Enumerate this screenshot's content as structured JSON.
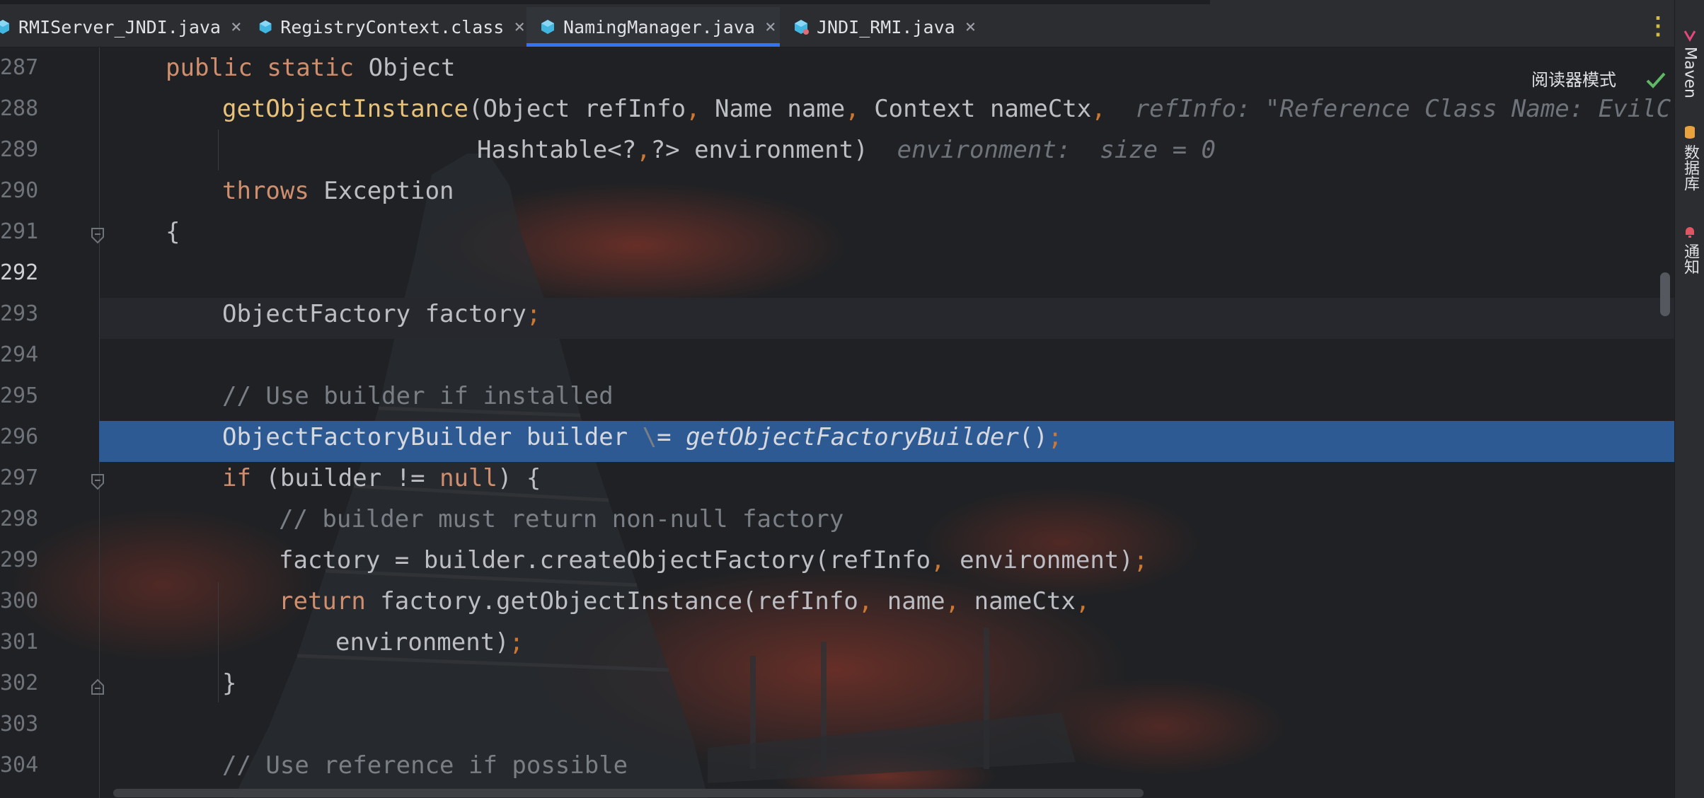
{
  "tabs": [
    {
      "label": "RMIServer_JNDI.java",
      "active": false
    },
    {
      "label": "RegistryContext.class",
      "active": false
    },
    {
      "label": "NamingManager.java",
      "active": true
    },
    {
      "label": "JNDI_RMI.java",
      "active": false
    }
  ],
  "tab_close_glyph": "×",
  "more_glyph": "⋮",
  "toolbar": {
    "reader_mode_label": "阅读器模式"
  },
  "right_tools": {
    "maven": "Maven",
    "database": "数据库",
    "notifications": "通知"
  },
  "colors": {
    "accent": "#3574f0",
    "selection": "#2e5a94",
    "keyword": "#cf8e6d",
    "function": "#e8c17a"
  },
  "editor": {
    "current_line": "292",
    "highlighted_line": "296",
    "lines": [
      {
        "num": "287"
      },
      {
        "num": "288"
      },
      {
        "num": "289"
      },
      {
        "num": "290"
      },
      {
        "num": "291"
      },
      {
        "num": "292"
      },
      {
        "num": "293"
      },
      {
        "num": "294"
      },
      {
        "num": "295"
      },
      {
        "num": "296"
      },
      {
        "num": "297"
      },
      {
        "num": "298"
      },
      {
        "num": "299"
      },
      {
        "num": "300"
      },
      {
        "num": "301"
      },
      {
        "num": "302"
      },
      {
        "num": "303"
      },
      {
        "num": "304"
      }
    ],
    "code": {
      "l287": {
        "kw1": "public",
        "kw2": "static",
        "type": "Object"
      },
      "l288": {
        "fn": "getObjectInstance",
        "open": "(",
        "p1": "Object refInfo",
        "c1": ",",
        "p2": " Name name",
        "c2": ",",
        "p3": " Context nameCtx",
        "c3": ",",
        "hint": "refInfo: \"Reference Class Name: EvilCla"
      },
      "l289": {
        "p": "Hashtable<?",
        "c": ",",
        "rest": "?> environment)",
        "hint": "environment:  size = 0"
      },
      "l290": {
        "kw": "throws",
        "exc": " Exception"
      },
      "l291": {
        "brace": "{"
      },
      "l293": {
        "text": "ObjectFactory factory",
        "semi": ";"
      },
      "l295": {
        "comment": "// Use builder if installed"
      },
      "l296": {
        "text": "ObjectFactoryBuilder builder ",
        "arrow": "\\",
        "eq": "= ",
        "call": "getObjectFactoryBuilder",
        "parens": "()",
        "semi": ";"
      },
      "l297": {
        "kw": "if",
        "mid": " (builder != ",
        "nul": "null",
        "end": ") {"
      },
      "l298": {
        "comment": "// builder must return non-null factory"
      },
      "l299": {
        "a": "factory = builder.createObjectFactory(refInfo",
        "c": ",",
        "b": " environment)",
        "semi": ";"
      },
      "l300": {
        "kw": "return",
        "a": " factory.getObjectInstance(refInfo",
        "c1": ",",
        "b": " name",
        "c2": ",",
        "d": " nameCtx",
        "c3": ","
      },
      "l301": {
        "text": "environment)",
        "semi": ";"
      },
      "l302": {
        "brace": "}"
      },
      "l304": {
        "comment": "// Use reference if possible"
      }
    }
  }
}
